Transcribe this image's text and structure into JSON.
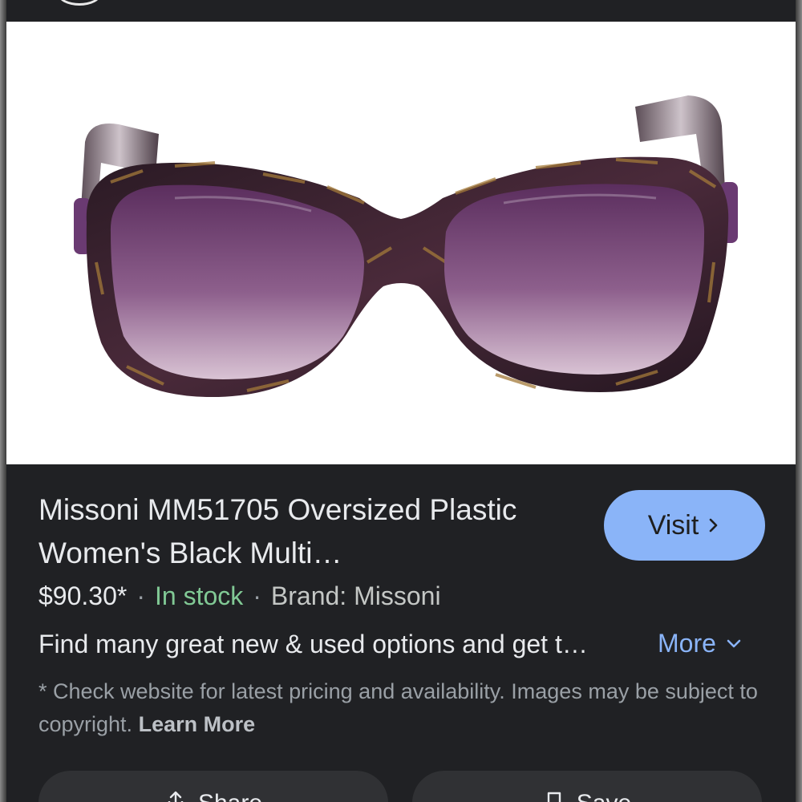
{
  "product": {
    "title": "Missoni MM51705 Oversized Plastic Women's Black Multi…",
    "price": "$90.30*",
    "separator": "·",
    "stock": "In stock",
    "brand": "Brand: Missoni",
    "description": "Find many great new & used options and get t…",
    "more_label": "More",
    "image_alt": "Missoni oversized sunglasses with purple gradient lenses"
  },
  "visit_button": {
    "label": "Visit"
  },
  "disclaimer": {
    "text": "* Check website for latest pricing and availability. Images may be subject to copyright.",
    "link_label": "Learn More"
  },
  "actions": {
    "share_label": "Share",
    "save_label": "Save"
  },
  "icons": {
    "visit": "chevron-right-icon",
    "more": "chevron-down-icon",
    "share": "share-icon",
    "save": "bookmark-icon"
  },
  "colors": {
    "background": "#202124",
    "visit_button": "#8ab4f8",
    "link": "#8ab4f8",
    "in_stock": "#81c995",
    "secondary_text": "#9aa0a6"
  }
}
